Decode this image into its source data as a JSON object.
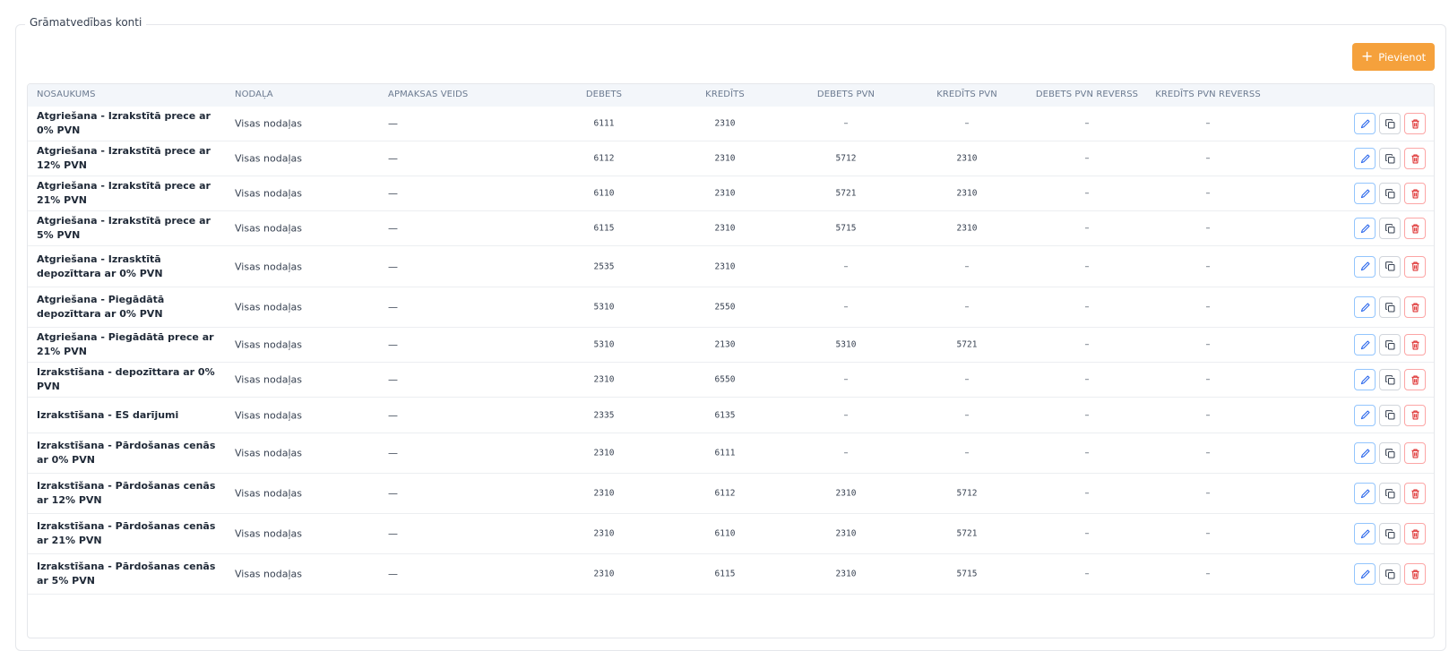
{
  "panel": {
    "legend": "Grāmatvedības konti"
  },
  "toolbar": {
    "add_label": "Pievienot",
    "add_icon": "plus-icon",
    "accent": "#f5a13c"
  },
  "table": {
    "headers": [
      "NOSAUKUMS",
      "NODAĻA",
      "APMAKSAS VEIDS",
      "DEBETS",
      "KREDĪTS",
      "DEBETS PVN",
      "KREDĪTS PVN",
      "DEBETS PVN REVERSS",
      "KREDĪTS PVN REVERSS"
    ],
    "rows": [
      {
        "name": "Atgriešana - Izrakstītā prece ar 0% PVN",
        "dept": "Visas nodaļas",
        "pay": "—",
        "debets": "6111",
        "kredits": "2310",
        "debets_pvn": "–",
        "kredits_pvn": "–",
        "debets_rev": "–",
        "kredits_rev": "–"
      },
      {
        "name": "Atgriešana - Izrakstītā prece ar 12% PVN",
        "dept": "Visas nodaļas",
        "pay": "—",
        "debets": "6112",
        "kredits": "2310",
        "debets_pvn": "5712",
        "kredits_pvn": "2310",
        "debets_rev": "–",
        "kredits_rev": "–"
      },
      {
        "name": "Atgriešana - Izrakstītā prece ar 21% PVN",
        "dept": "Visas nodaļas",
        "pay": "—",
        "debets": "6110",
        "kredits": "2310",
        "debets_pvn": "5721",
        "kredits_pvn": "2310",
        "debets_rev": "–",
        "kredits_rev": "–"
      },
      {
        "name": "Atgriešana - Izrakstītā prece ar 5% PVN",
        "dept": "Visas nodaļas",
        "pay": "—",
        "debets": "6115",
        "kredits": "2310",
        "debets_pvn": "5715",
        "kredits_pvn": "2310",
        "debets_rev": "–",
        "kredits_rev": "–"
      },
      {
        "name": "Atgriešana - Izrasktītā depozīttara ar 0% PVN",
        "dept": "Visas nodaļas",
        "pay": "—",
        "debets": "2535",
        "kredits": "2310",
        "debets_pvn": "–",
        "kredits_pvn": "–",
        "debets_rev": "–",
        "kredits_rev": "–"
      },
      {
        "name": "Atgriešana - Piegādātā depozīttara ar 0% PVN",
        "dept": "Visas nodaļas",
        "pay": "—",
        "debets": "5310",
        "kredits": "2550",
        "debets_pvn": "–",
        "kredits_pvn": "–",
        "debets_rev": "–",
        "kredits_rev": "–"
      },
      {
        "name": "Atgriešana - Piegādātā prece ar 21% PVN",
        "dept": "Visas nodaļas",
        "pay": "—",
        "debets": "5310",
        "kredits": "2130",
        "debets_pvn": "5310",
        "kredits_pvn": "5721",
        "debets_rev": "–",
        "kredits_rev": "–"
      },
      {
        "name": "Izrakstīšana - depozīttara ar 0% PVN",
        "dept": "Visas nodaļas",
        "pay": "—",
        "debets": "2310",
        "kredits": "6550",
        "debets_pvn": "–",
        "kredits_pvn": "–",
        "debets_rev": "–",
        "kredits_rev": "–"
      },
      {
        "name": "Izrakstīšana - ES darījumi",
        "dept": "Visas nodaļas",
        "pay": "—",
        "debets": "2335",
        "kredits": "6135",
        "debets_pvn": "–",
        "kredits_pvn": "–",
        "debets_rev": "–",
        "kredits_rev": "–"
      },
      {
        "name": "Izrakstīšana - Pārdošanas cenās ar 0% PVN",
        "dept": "Visas nodaļas",
        "pay": "—",
        "debets": "2310",
        "kredits": "6111",
        "debets_pvn": "–",
        "kredits_pvn": "–",
        "debets_rev": "–",
        "kredits_rev": "–"
      },
      {
        "name": "Izrakstīšana - Pārdošanas cenās ar 12% PVN",
        "dept": "Visas nodaļas",
        "pay": "—",
        "debets": "2310",
        "kredits": "6112",
        "debets_pvn": "2310",
        "kredits_pvn": "5712",
        "debets_rev": "–",
        "kredits_rev": "–"
      },
      {
        "name": "Izrakstīšana - Pārdošanas cenās ar 21% PVN",
        "dept": "Visas nodaļas",
        "pay": "—",
        "debets": "2310",
        "kredits": "6110",
        "debets_pvn": "2310",
        "kredits_pvn": "5721",
        "debets_rev": "–",
        "kredits_rev": "–"
      },
      {
        "name": "Izrakstīšana - Pārdošanas cenās ar 5% PVN",
        "dept": "Visas nodaļas",
        "pay": "—",
        "debets": "2310",
        "kredits": "6115",
        "debets_pvn": "2310",
        "kredits_pvn": "5715",
        "debets_rev": "–",
        "kredits_rev": "–"
      }
    ],
    "row_actions": {
      "edit_icon": "pencil-icon",
      "copy_icon": "copy-icon",
      "delete_icon": "trash-icon"
    }
  },
  "colors": {
    "edit": "#2563eb",
    "delete": "#dc2626",
    "header_bg": "#f3f6fa"
  }
}
